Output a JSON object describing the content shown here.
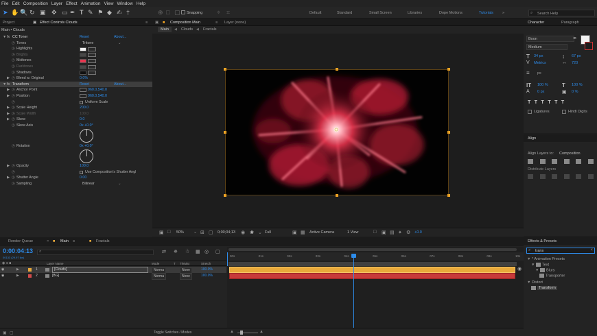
{
  "menubar": [
    "File",
    "Edit",
    "Composition",
    "Layer",
    "Effect",
    "Animation",
    "View",
    "Window",
    "Help"
  ],
  "toolbar": {
    "snapping_label": "Snapping",
    "workspaces": [
      "Default",
      "Standard",
      "Small Screen",
      "Libraries",
      "Dope Motions",
      "Tutorials"
    ],
    "active_workspace": "Tutorials",
    "search_placeholder": "Search Help"
  },
  "left_panel": {
    "tabs": [
      "Project",
      "Effect Controls Clouds"
    ],
    "breadcrumb": "Main • Clouds",
    "effects": [
      {
        "label": "CC Toner",
        "value": "Reset",
        "extra": "About...",
        "type": "fx-header"
      },
      {
        "label": "Tones",
        "value": "Tritone",
        "type": "dropdown"
      },
      {
        "label": "Highlights",
        "swatch": "#f3f3f3",
        "type": "color"
      },
      {
        "label": "Brights",
        "swatch": "#6b6b6b",
        "type": "color-dim"
      },
      {
        "label": "Midtones",
        "swatch": "#e8364f",
        "type": "color"
      },
      {
        "label": "Darktones",
        "swatch": "#6b6b6b",
        "type": "color-dim"
      },
      {
        "label": "Shadows",
        "swatch": "#111111",
        "type": "color"
      },
      {
        "label": "Blend w. Original",
        "value": "0.0%",
        "type": "value"
      },
      {
        "label": "Transform",
        "value": "Reset",
        "extra": "About...",
        "type": "fx-header-selected"
      },
      {
        "label": "Anchor Point",
        "value": "960.0,540.0",
        "type": "point"
      },
      {
        "label": "Position",
        "value": "960.0,540.0",
        "type": "point"
      },
      {
        "label": "",
        "value": "Uniform Scale",
        "type": "checkbox"
      },
      {
        "label": "Scale Height",
        "value": "200.0",
        "type": "value"
      },
      {
        "label": "Scale Width",
        "value": "100.0",
        "type": "value-dim"
      },
      {
        "label": "Skew",
        "value": "0.0",
        "type": "value"
      },
      {
        "label": "Skew Axis",
        "value": "0x +0.0°",
        "type": "angle"
      },
      {
        "label": "Rotation",
        "value": "0x +0.0°",
        "type": "angle"
      },
      {
        "label": "Opacity",
        "value": "100.0",
        "type": "value"
      },
      {
        "label": "",
        "value": "Use Composition's Shutter Angl",
        "type": "checkbox"
      },
      {
        "label": "Shutter Angle",
        "value": "0.00",
        "type": "value"
      },
      {
        "label": "Sampling",
        "value": "Bilinear",
        "type": "dropdown"
      }
    ]
  },
  "comp_panel": {
    "tabs": [
      "Composition Main",
      "Layer (none)"
    ],
    "subtabs": [
      "Main",
      "Clouds",
      "Fractals"
    ],
    "bottom_bar": {
      "zoom": "50%",
      "timecode": "0;00;04;13",
      "resolution": "Full",
      "camera": "Active Camera",
      "views": "1 View",
      "exposure": "+0.0"
    }
  },
  "character": {
    "tabs": [
      "Character",
      "Paragraph"
    ],
    "font": "Boon",
    "style": "Medium",
    "size": "34 px",
    "leading": "67 px",
    "kerning": "Metrics",
    "tracking": "720",
    "stroke": "px",
    "vscale": "100 %",
    "hscale": "100 %",
    "baseline": "0 px",
    "tsume": "0 %",
    "ligatures": "Ligatures",
    "hindi": "Hindi Digits"
  },
  "align": {
    "title": "Align",
    "align_to_label": "Align Layers to:",
    "align_to": "Composition",
    "distribute_label": "Distribute Layers"
  },
  "effects_presets": {
    "title": "Effects & Presets",
    "search_value": "trans",
    "tree": [
      {
        "label": "* Animation Presets",
        "depth": 0
      },
      {
        "label": "Text",
        "depth": 1
      },
      {
        "label": "Blurs",
        "depth": 2
      },
      {
        "label": "Transporter",
        "depth": 3
      },
      {
        "label": "Distort",
        "depth": 0
      },
      {
        "label": "Transform",
        "depth": 1,
        "selected": true
      }
    ]
  },
  "timeline": {
    "tabs": [
      "Render Queue",
      "Main",
      "Fractals"
    ],
    "timecode": "0:00:04:13",
    "timecode_sub": "00133 (29.97 fps)",
    "columns": [
      "Layer Name",
      "Mode",
      "T",
      "TrkMat",
      "Stretch"
    ],
    "layers": [
      {
        "num": "1",
        "name": "[Clouds]",
        "mode": "Norma",
        "trkmat": "None",
        "stretch": "100.0%",
        "color": "#e8a93b",
        "selected": true
      },
      {
        "num": "2",
        "name": "[BG]",
        "mode": "Norma",
        "trkmat": "None",
        "stretch": "100.0%",
        "color": "#d24b4b",
        "selected": false
      }
    ],
    "ticks": [
      "00s",
      "01s",
      "02s",
      "03s",
      "04s",
      "05s",
      "06s",
      "07s",
      "08s",
      "09s",
      "10s"
    ],
    "toggle_label": "Toggle Switches / Modes"
  },
  "colors": {
    "accent": "#2d8ceb",
    "handle": "#f5a623",
    "layer1": "#e8a93b",
    "layer2": "#c73a3a"
  }
}
